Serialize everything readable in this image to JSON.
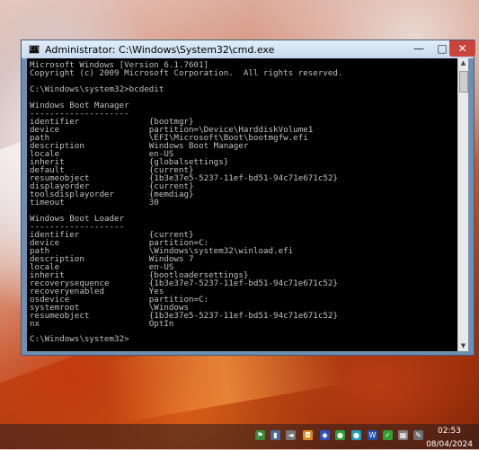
{
  "window": {
    "title": "Administrator: C:\\Windows\\System32\\cmd.exe",
    "icon_text": "C:\\",
    "minimize_glyph": "—",
    "maximize_glyph": "□",
    "close_glyph": "✕"
  },
  "console": {
    "lines": [
      "Microsoft Windows [Version 6.1.7601]",
      "Copyright (c) 2009 Microsoft Corporation.  All rights reserved.",
      "",
      "C:\\Windows\\system32>bcdedit",
      "",
      "Windows Boot Manager",
      "--------------------",
      "identifier              {bootmgr}",
      "device                  partition=\\Device\\HarddiskVolume1",
      "path                    \\EFI\\Microsoft\\Boot\\bootmgfw.efi",
      "description             Windows Boot Manager",
      "locale                  en-US",
      "inherit                 {globalsettings}",
      "default                 {current}",
      "resumeobject            {1b3e37e5-5237-11ef-bd51-94c71e671c52}",
      "displayorder            {current}",
      "toolsdisplayorder       {memdiag}",
      "timeout                 30",
      "",
      "Windows Boot Loader",
      "-------------------",
      "identifier              {current}",
      "device                  partition=C:",
      "path                    \\Windows\\system32\\winload.efi",
      "description             Windows 7",
      "locale                  en-US",
      "inherit                 {bootloadersettings}",
      "recoverysequence        {1b3e37e7-5237-11ef-bd51-94c71e671c52}",
      "recoveryenabled         Yes",
      "osdevice                partition=C:",
      "systemroot              \\Windows",
      "resumeobject            {1b3e37e5-5237-11ef-bd51-94c71e671c52}",
      "nx                      OptIn",
      "",
      "C:\\Windows\\system32>"
    ]
  },
  "scrollbar": {
    "up_glyph": "▲",
    "down_glyph": "▼"
  },
  "taskbar": {
    "tray_icons": [
      {
        "name": "flag-icon",
        "glyph": "⚑",
        "color": "#3a8a3a"
      },
      {
        "name": "network-icon",
        "glyph": "▮",
        "color": "#4a6a9a"
      },
      {
        "name": "volume-icon",
        "glyph": "◄",
        "color": "#777777"
      },
      {
        "name": "app-orange-icon",
        "glyph": "◘",
        "color": "#e08a20"
      },
      {
        "name": "app-blue-icon",
        "glyph": "◆",
        "color": "#3050c0"
      },
      {
        "name": "app-green-icon",
        "glyph": "●",
        "color": "#2aa040"
      },
      {
        "name": "app-cyan-icon",
        "glyph": "●",
        "color": "#20a0c0"
      },
      {
        "name": "app-w-icon",
        "glyph": "W",
        "color": "#2050b0"
      },
      {
        "name": "app-check-icon",
        "glyph": "✓",
        "color": "#30a030"
      },
      {
        "name": "app-grid-icon",
        "glyph": "▦",
        "color": "#808080"
      },
      {
        "name": "app-pen-icon",
        "glyph": "✎",
        "color": "#707070"
      },
      {
        "name": "speaker-icon",
        "glyph": "♪",
        "color": "#808080"
      }
    ],
    "clock_time": "02:53",
    "clock_date": "08/04/2024"
  }
}
